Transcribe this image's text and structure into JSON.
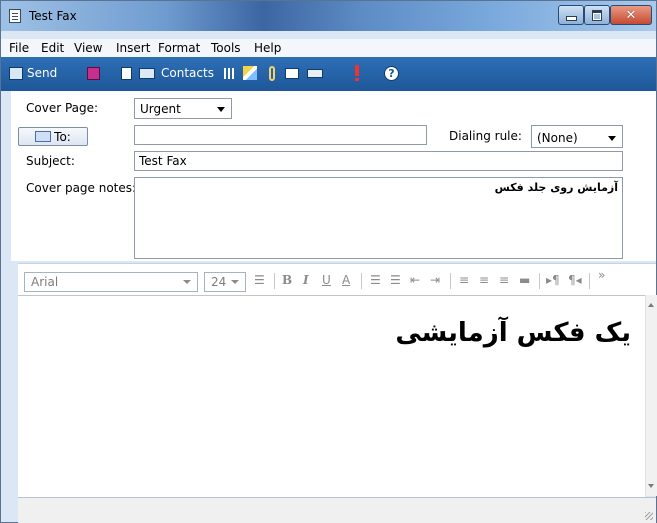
{
  "window": {
    "title": "Test Fax"
  },
  "menu": [
    "File",
    "Edit",
    "View",
    "Insert",
    "Format",
    "Tools",
    "Help"
  ],
  "toolbar": {
    "send_label": "Send",
    "contacts_label": "Contacts",
    "icons": [
      "send-icon",
      "save-icon",
      "document-icon",
      "contacts-icon",
      "grid-icon",
      "spellcheck-icon",
      "attach-icon",
      "image-icon",
      "scan-icon",
      "priority-icon",
      "help-icon"
    ]
  },
  "header": {
    "cover_page_label": "Cover Page:",
    "cover_page_value": "Urgent",
    "to_label": "To:",
    "to_value": "",
    "dialing_rule_label": "Dialing rule:",
    "dialing_rule_value": "(None)",
    "subject_label": "Subject:",
    "subject_value": "Test Fax",
    "notes_label": "Cover page notes:",
    "notes_value": "آزمایش روی جلد فکس"
  },
  "format": {
    "font": "Arial",
    "size": "24",
    "bold": "B",
    "italic": "I",
    "underline": "U",
    "font_color": "A",
    "more": "»"
  },
  "editor": {
    "body_text": "یک فکس آزمایشی"
  },
  "colors": {
    "toolbar_bg": "#1d5799",
    "title_bar": "#3c66a2",
    "panel_bg": "#dbe7f5"
  }
}
